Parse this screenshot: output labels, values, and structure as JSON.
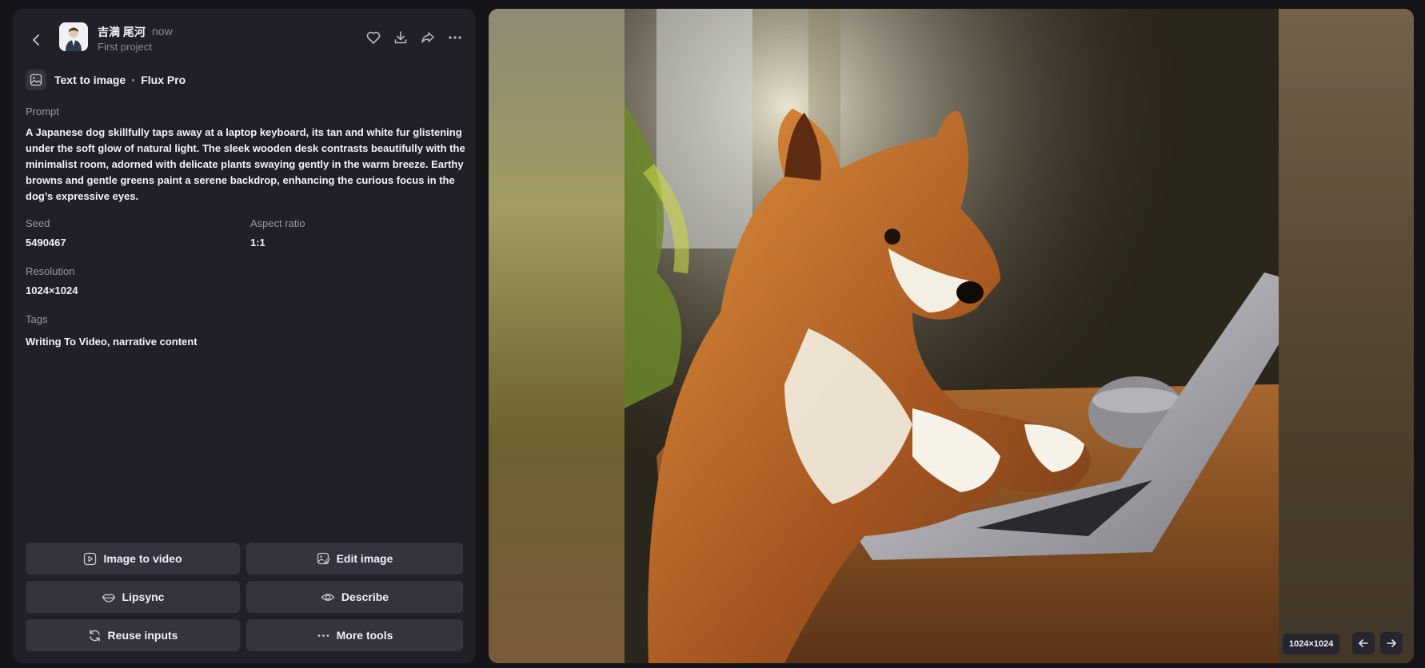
{
  "header": {
    "user_name": "吉満 尾河",
    "time": "now",
    "project": "First project"
  },
  "model": {
    "mode": "Text to image",
    "name": "Flux Pro"
  },
  "details": {
    "prompt_label": "Prompt",
    "prompt": "A Japanese dog skillfully taps away at a laptop keyboard, its tan and white fur glistening under the soft glow of natural light. The sleek wooden desk contrasts beautifully with the minimalist room, adorned with delicate plants swaying gently in the warm breeze. Earthy browns and gentle greens paint a serene backdrop, enhancing the curious focus in the dog’s expressive eyes.",
    "seed_label": "Seed",
    "seed": "5490467",
    "aspect_label": "Aspect ratio",
    "aspect": "1:1",
    "resolution_label": "Resolution",
    "resolution": "1024×1024",
    "tags_label": "Tags",
    "tags": "Writing To Video, narrative content"
  },
  "actions": {
    "image_to_video": "Image to video",
    "edit_image": "Edit image",
    "lipsync": "Lipsync",
    "describe": "Describe",
    "reuse_inputs": "Reuse inputs",
    "more_tools": "More tools"
  },
  "viewer": {
    "size_badge": "1024×1024",
    "image_subject": "dog-at-laptop-photo"
  },
  "colors": {
    "panel_bg": "#212029",
    "page_bg": "#141419",
    "button_bg": "#34333e",
    "muted_text": "#9a99a6"
  }
}
